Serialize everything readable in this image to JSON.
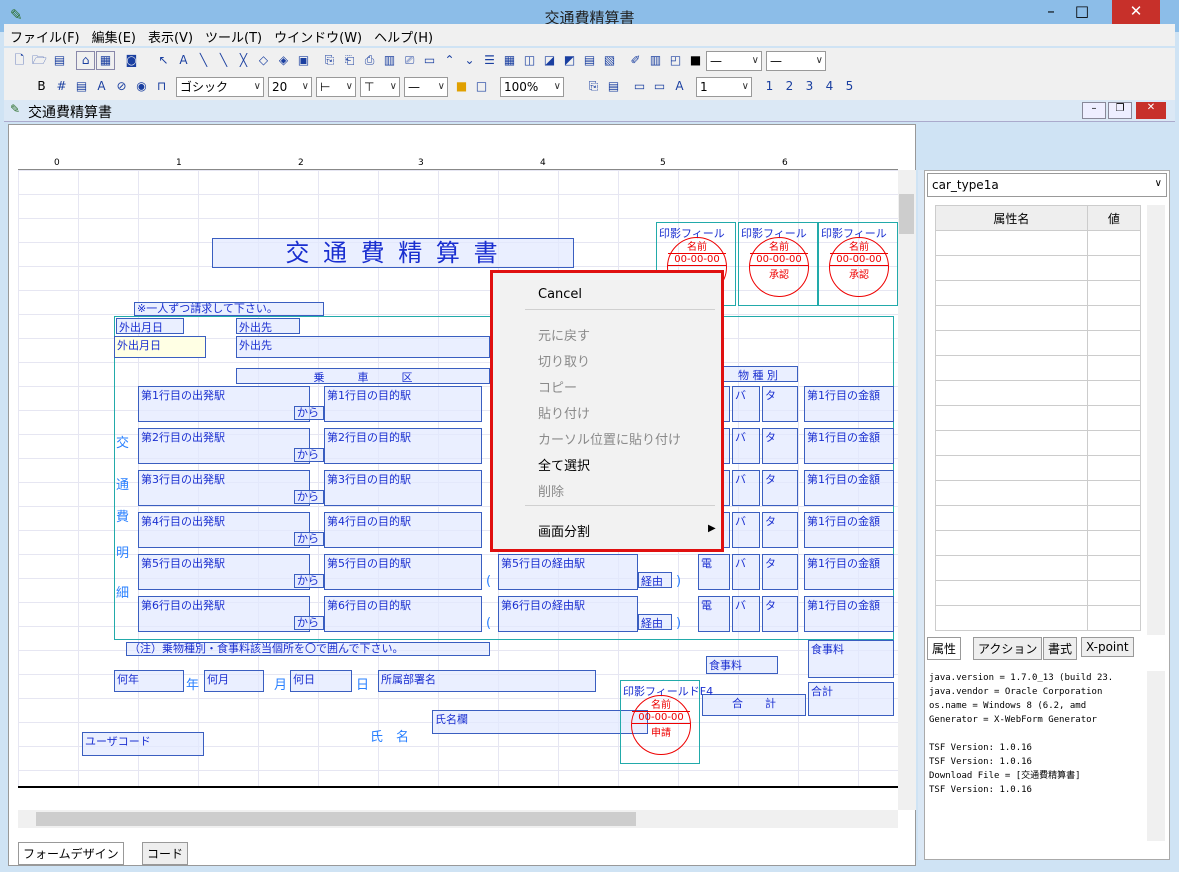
{
  "window": {
    "title": "交通費精算書"
  },
  "menu": [
    "ファイル(F)",
    "編集(E)",
    "表示(V)",
    "ツール(T)",
    "ウインドウ(W)",
    "ヘルプ(H)"
  ],
  "toolbar2": {
    "font": "ゴシック",
    "size": "20",
    "zoom": "100%",
    "page": "1"
  },
  "doc": {
    "title": "交通費精算書"
  },
  "ruler": [
    "0",
    "1",
    "2",
    "3",
    "4",
    "5",
    "6"
  ],
  "form": {
    "title": "交 通 費 精 算 書",
    "note1": "※一人ずつ請求して下さい。",
    "outdate_label": "外出月日",
    "outdate_field": "外出月日",
    "dest_label": "外出先",
    "dest_field": "外出先",
    "section": "乗　　　車　　　区",
    "vehicle_header": "物 種 別",
    "vertical": [
      "交",
      "通",
      "費",
      "明",
      "細"
    ],
    "rows": [
      {
        "from": "第1行目の出発駅",
        "to": "第1行目の目的駅"
      },
      {
        "from": "第2行目の出発駅",
        "to": "第2行目の目的駅"
      },
      {
        "from": "第3行目の出発駅",
        "to": "第3行目の目的駅"
      },
      {
        "from": "第4行目の出発駅",
        "to": "第4行目の目的駅"
      },
      {
        "from": "第5行目の出発駅",
        "to": "第5行目の目的駅",
        "via": "第5行目の経由駅"
      },
      {
        "from": "第6行目の出発駅",
        "to": "第6行目の目的駅",
        "via": "第6行目の経由駅"
      }
    ],
    "kara": "から",
    "keiyu": "経由",
    "den": "電",
    "ha": "バ",
    "ta": "タ",
    "amount": "第1行目の金額",
    "note2": "（注）乗物種別・食事料該当個所を〇で囲んで下さい。",
    "meal_label": "食事料",
    "meal_field": "食事料",
    "total_label": "合　　計",
    "total_field": "合計",
    "year_field": "何年",
    "year": "年",
    "month_field": "何月",
    "month": "月",
    "day_field": "何日",
    "day": "日",
    "dept": "所属部署名",
    "name_label": "氏　名",
    "name_field": "氏名欄",
    "user_code": "ユーザコード",
    "stamps": [
      {
        "title": "印影フィール",
        "name": "名前",
        "date": "00-00-00",
        "role": ""
      },
      {
        "title": "印影フィール",
        "name": "名前",
        "date": "00-00-00",
        "role": "承認"
      },
      {
        "title": "印影フィール",
        "name": "名前",
        "date": "00-00-00",
        "role": "承認"
      },
      {
        "title": "印影フィールドF4",
        "name": "名前",
        "date": "00-00-00",
        "role": "申請"
      }
    ]
  },
  "context_menu": [
    "Cancel",
    "元に戻す",
    "切り取り",
    "コピー",
    "貼り付け",
    "カーソル位置に貼り付け",
    "全て選択",
    "削除",
    "画面分割"
  ],
  "bottom_tabs": [
    "フォームデザイン",
    "コード"
  ],
  "right": {
    "combo": "car_type1a",
    "col_name": "属性名",
    "col_value": "値",
    "tabs": [
      "属性",
      "アクション",
      "書式",
      "X-point"
    ],
    "log": [
      "java.version = 1.7.0_13 (build 23.",
      "java.vendor  = Oracle Corporation",
      "os.name      = Windows 8 (6.2, amd",
      "Generator    = X-WebForm Generator",
      "",
      "TSF Version: 1.0.16",
      "TSF Version: 1.0.16",
      "Download File = [交通費精算書]",
      "TSF Version: 1.0.16"
    ]
  }
}
